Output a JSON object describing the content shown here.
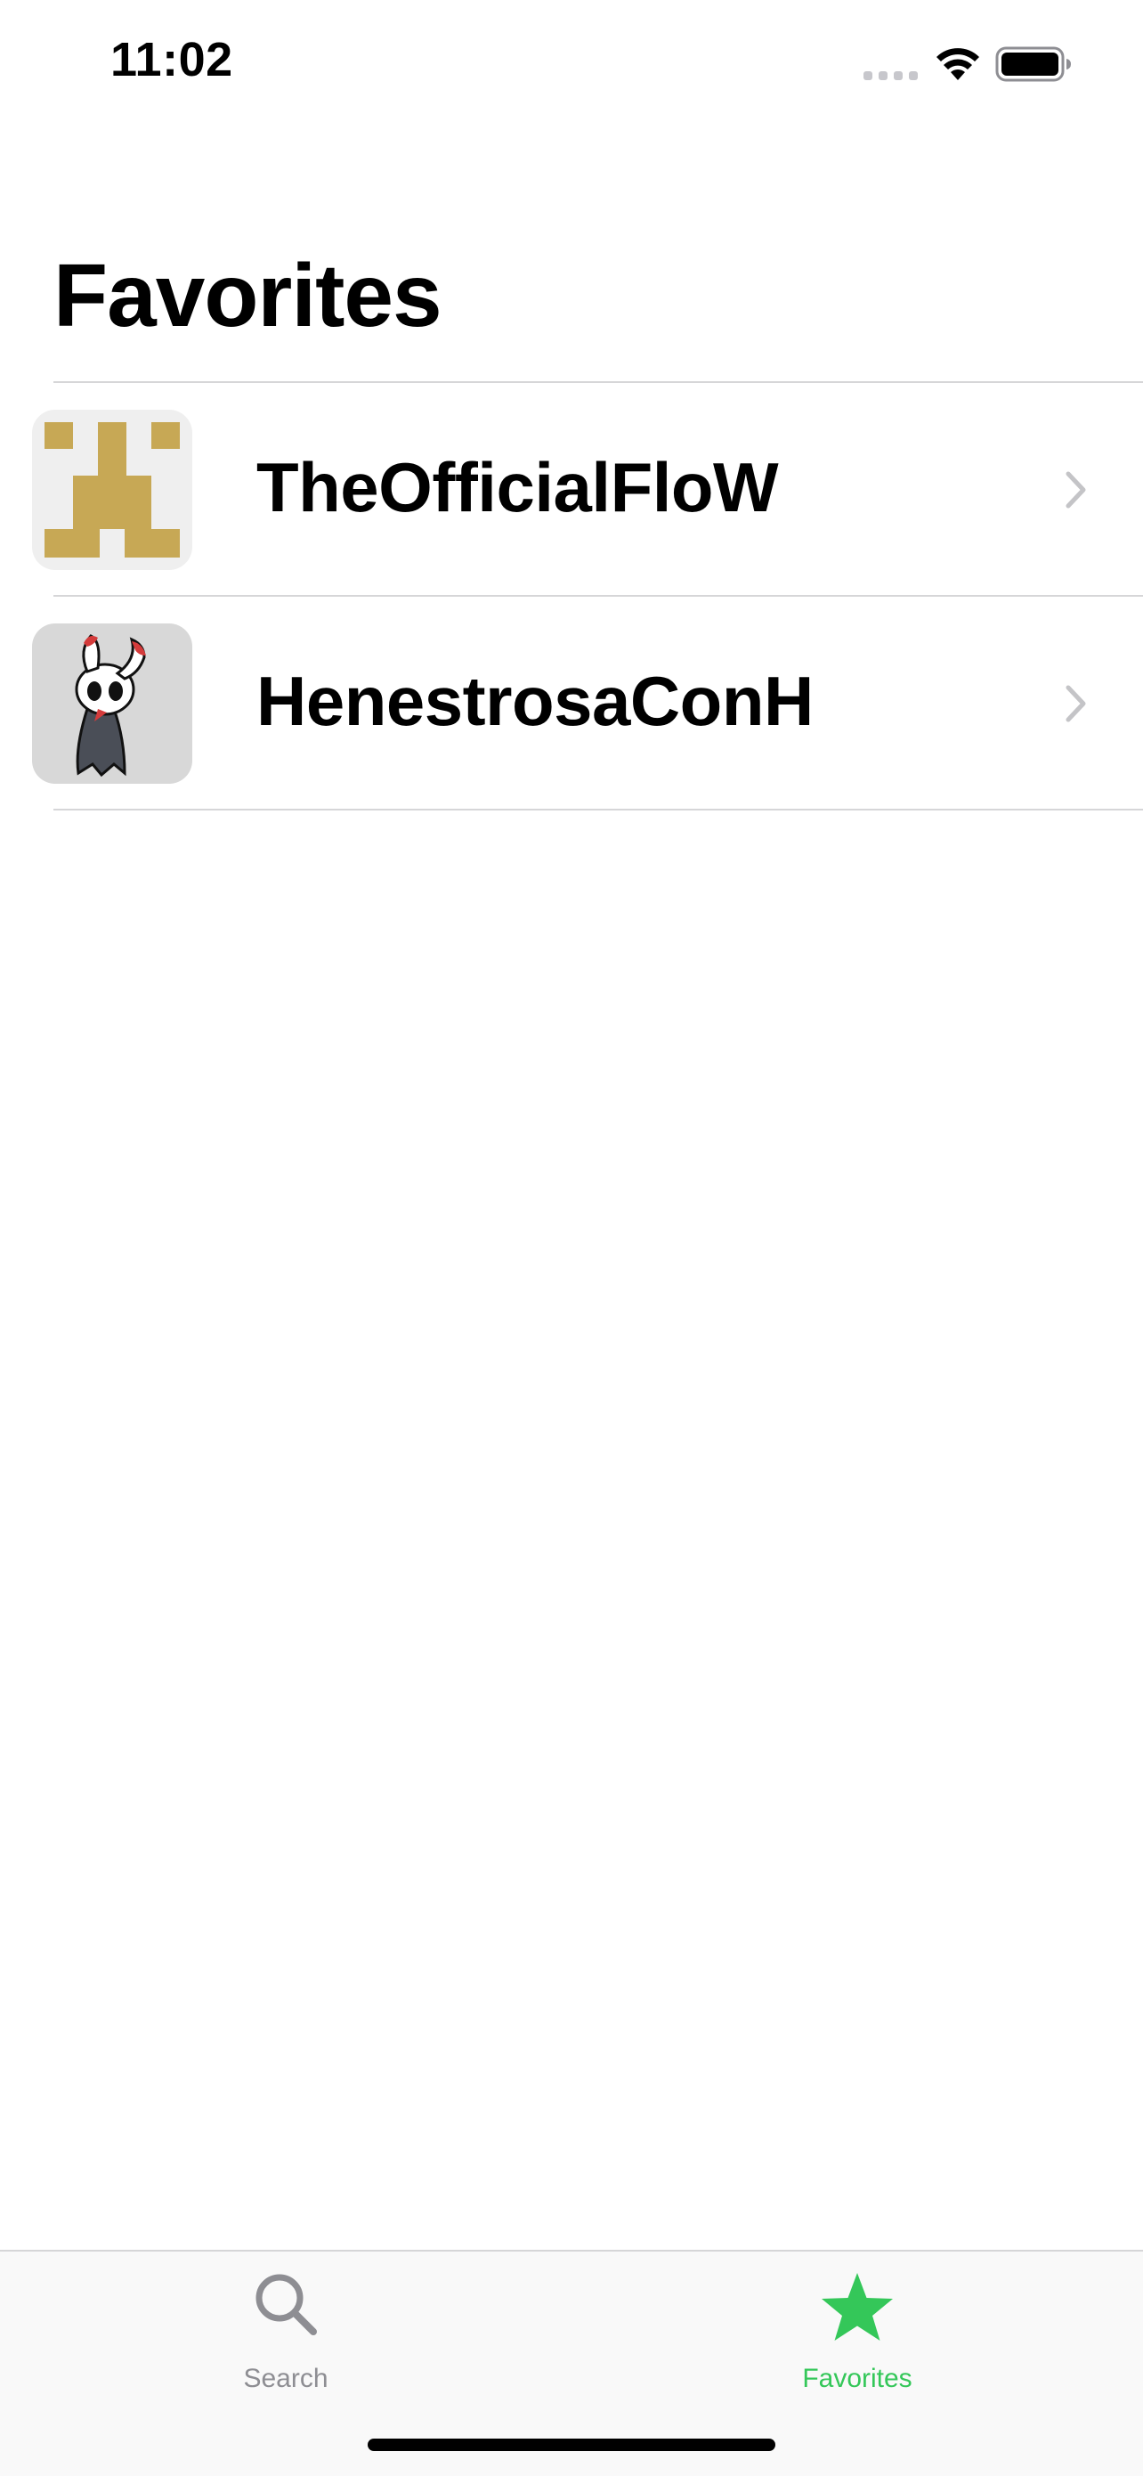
{
  "status_bar": {
    "time": "11:02"
  },
  "title": "Favorites",
  "favorites": [
    {
      "name": "TheOfficialFloW",
      "avatar_icon": "pixel-invader-avatar-icon"
    },
    {
      "name": "HenestrosaConH",
      "avatar_icon": "cartoon-character-avatar-icon"
    }
  ],
  "tab_bar": {
    "tabs": [
      {
        "label": "Search",
        "icon": "search-icon",
        "active": false
      },
      {
        "label": "Favorites",
        "icon": "star-icon",
        "active": true
      }
    ]
  },
  "colors": {
    "accent": "#34C759",
    "inactive": "#8E8E93",
    "avatar_gold": "#C7A855",
    "chevron": "#C4C4C7"
  }
}
